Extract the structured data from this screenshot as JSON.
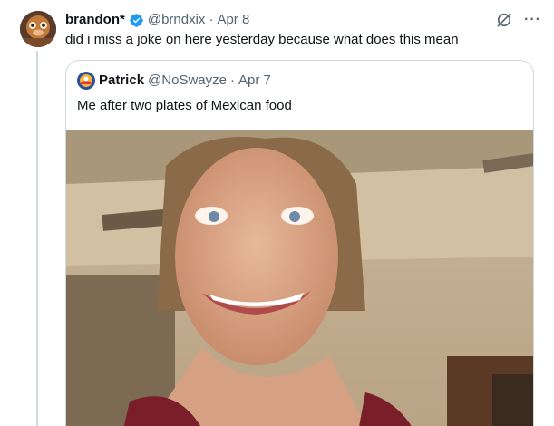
{
  "tweet": {
    "author_name": "brandon*",
    "author_handle": "@brndxix",
    "separator": "·",
    "date": "Apr 8",
    "text": "did i miss a joke on here yesterday because what does this mean",
    "more_label": "···"
  },
  "quoted": {
    "author_name": "Patrick",
    "author_handle": "@NoSwayze",
    "separator": "·",
    "date": "Apr 7",
    "text": "Me after two plates of Mexican food",
    "media_icon": "video-frame-photo"
  },
  "colors": {
    "verified": "#1d9bf0",
    "secondary_text": "#536471",
    "border": "#cfd9de"
  }
}
